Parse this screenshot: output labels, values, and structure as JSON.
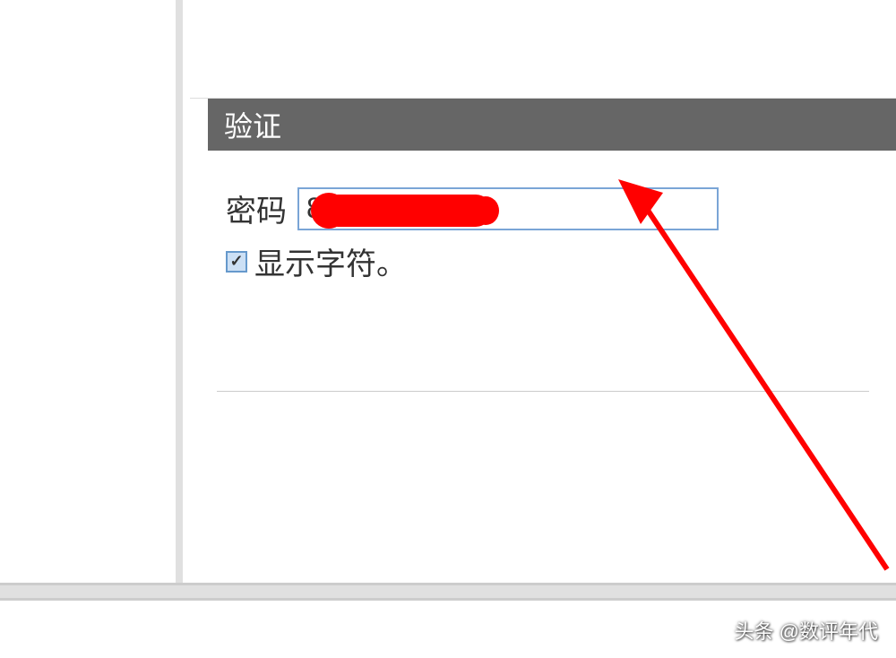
{
  "section": {
    "title": "验证"
  },
  "password": {
    "label": "密码",
    "visible_char": "8"
  },
  "checkbox": {
    "label": "显示字符。"
  },
  "watermark": "头条 @数评年代"
}
